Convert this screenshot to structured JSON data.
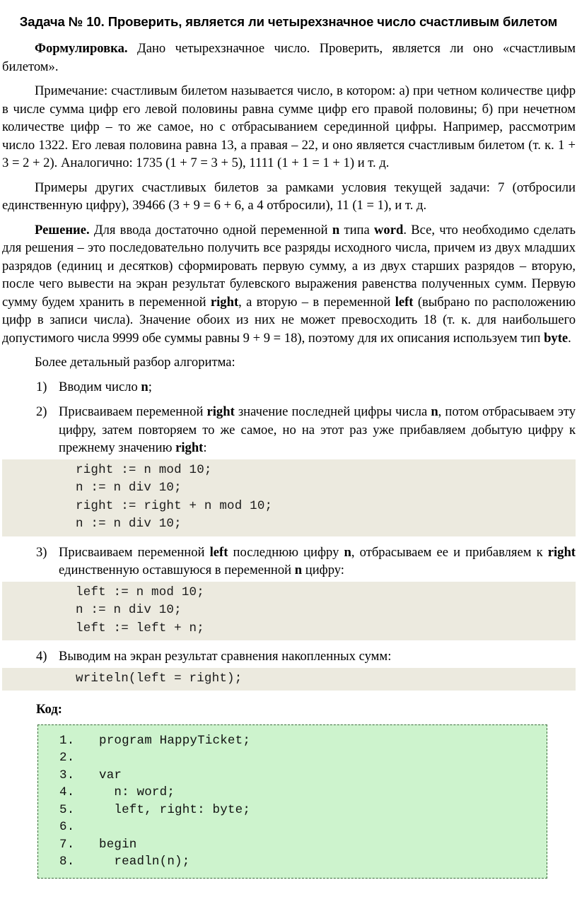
{
  "document": {
    "title": "Задача № 10. Проверить, является ли четырехзначное число счастливым билетом",
    "paragraphs": {
      "formulation_label": "Формулировка.",
      "formulation_text": " Дано четырехзначное число. Проверить, является ли оно «счастливым билетом».",
      "note": "Примечание: счастливым билетом называется число, в котором: а) при четном количестве цифр в числе сумма цифр его левой половины равна сумме цифр его правой половины; б) при нечетном количестве цифр – то же самое, но с отбрасыванием серединной цифры. Например, рассмотрим число 1322. Его левая половина равна 13, а правая – 22, и оно является счастливым билетом (т. к. 1 + 3 = 2 + 2). Аналогично: 1735 (1 + 7 = 3 + 5), 1111 (1 + 1 = 1 + 1) и т. д.",
      "examples": "Примеры других счастливых билетов за рамками условия текущей задачи: 7 (отбросили единственную цифру), 39466 (3 + 9 = 6 + 6, а 4 отбросили), 11 (1 = 1), и т. д.",
      "solution_label": "Решение.",
      "solution_part1": " Для ввода достаточно одной переменной ",
      "solution_var_n": "n",
      "solution_part2": " типа ",
      "solution_type_word": "word",
      "solution_part3": ". Все, что необходимо сделать для решения – это последовательно получить все разряды исходного числа, причем из двух младших разрядов (единиц и десятков) сформировать первую сумму, а из двух старших разрядов – вторую, после чего вывести на экран результат булевского выражения равенства полученных сумм. Первую сумму будем хранить в переменной ",
      "solution_var_right": "right",
      "solution_part4": ", а вторую – в переменной ",
      "solution_var_left": "left",
      "solution_part5": " (выбрано по расположению цифр в записи числа). Значение обоих из них не может превосходить 18 (т. к. для наибольшего допустимого числа 9999 обе суммы равны 9 + 9 = 18), поэтому для их описания используем тип ",
      "solution_type_byte": "byte",
      "solution_part6": ".",
      "algorithm_intro": "Более детальный разбор алгоритма:"
    },
    "steps": [
      {
        "marker": "1)",
        "parts": [
          {
            "text": "Вводим число ",
            "bold": false
          },
          {
            "text": "n",
            "bold": true
          },
          {
            "text": ";",
            "bold": false
          }
        ],
        "code": []
      },
      {
        "marker": "2)",
        "parts": [
          {
            "text": "Присваиваем переменной ",
            "bold": false
          },
          {
            "text": "right",
            "bold": true
          },
          {
            "text": " значение последней цифры числа ",
            "bold": false
          },
          {
            "text": "n",
            "bold": true
          },
          {
            "text": ", потом отбрасываем эту цифру, затем повторяем то же самое, но на этот раз уже прибавляем добытую цифру к прежнему значению ",
            "bold": false
          },
          {
            "text": "right",
            "bold": true
          },
          {
            "text": ":",
            "bold": false
          }
        ],
        "code": [
          "right := n mod 10;",
          "n := n div 10;",
          "right := right + n mod 10;",
          "n := n div 10;"
        ]
      },
      {
        "marker": "3)",
        "parts": [
          {
            "text": "Присваиваем переменной ",
            "bold": false
          },
          {
            "text": "left",
            "bold": true
          },
          {
            "text": " последнюю цифру ",
            "bold": false
          },
          {
            "text": "n",
            "bold": true
          },
          {
            "text": ", отбрасываем ее и прибавляем к ",
            "bold": false
          },
          {
            "text": "right",
            "bold": true
          },
          {
            "text": " единственную оставшуюся в переменной ",
            "bold": false
          },
          {
            "text": "n",
            "bold": true
          },
          {
            "text": " цифру:",
            "bold": false
          }
        ],
        "code": [
          "left := n mod 10;",
          "n := n div 10;",
          "left := left + n;"
        ]
      },
      {
        "marker": "4)",
        "parts": [
          {
            "text": "Выводим на экран результат сравнения накопленных сумм:",
            "bold": false
          }
        ],
        "code": [
          "writeln(left = right);"
        ]
      }
    ],
    "code_section": {
      "label": "Код:",
      "lines": [
        {
          "num": "1.",
          "text": "program HappyTicket;"
        },
        {
          "num": "2.",
          "text": ""
        },
        {
          "num": "3.",
          "text": "var"
        },
        {
          "num": "4.",
          "text": "  n: word;"
        },
        {
          "num": "5.",
          "text": "  left, right: byte;"
        },
        {
          "num": "6.",
          "text": ""
        },
        {
          "num": "7.",
          "text": "begin"
        },
        {
          "num": "8.",
          "text": "  readln(n);"
        }
      ]
    },
    "colors": {
      "code_inline_bg": "#eceadf",
      "code_listing_bg": "#cdf3cd",
      "code_listing_border": "#3c6e3c",
      "text": "#000000",
      "page_bg": "#ffffff"
    }
  }
}
